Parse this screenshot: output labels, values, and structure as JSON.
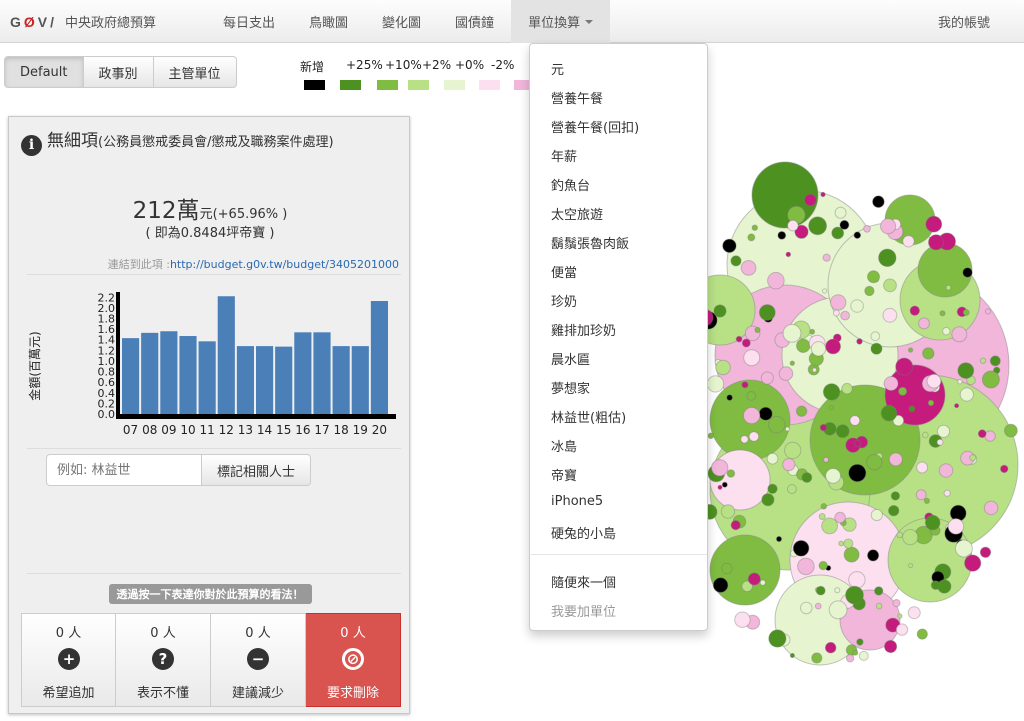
{
  "navbar": {
    "logo": "GØV",
    "brand_title": "中央政府總預算",
    "items": [
      {
        "label": "每日支出"
      },
      {
        "label": "鳥瞰圖"
      },
      {
        "label": "變化圖"
      },
      {
        "label": "國債鐘"
      },
      {
        "label": "單位換算"
      }
    ],
    "account": "我的帳號"
  },
  "view_buttons": [
    "Default",
    "政事別",
    "主管單位"
  ],
  "legend": {
    "labels": [
      "新增",
      "+25%",
      "+10%",
      "+2%",
      "+0%",
      "-2%"
    ],
    "colors": [
      "#000000",
      "#4d9221",
      "#7fbc41",
      "#b8e186",
      "#e6f5d0",
      "#fde0ef",
      "#f1b6da"
    ]
  },
  "panel": {
    "title": "無細項",
    "subtitle": "(公務員懲戒委員會/懲戒及職務案件處理)",
    "amount": "212萬",
    "amount_unit": "元",
    "change": "(+65.96% )",
    "equiv": "( 即為0.8484坪帝寶 )",
    "link_label": "連結到此項 :",
    "link_url": "http://budget.g0v.tw/budget/3405201000",
    "search_placeholder": "例如: 林益世",
    "search_button": "標記相關人士",
    "opinion_prompt": "透過按一下表達你對於此預算的看法！",
    "votes": [
      {
        "count": "0 人",
        "label": "希望追加",
        "icon": "plus-icon"
      },
      {
        "count": "0 人",
        "label": "表示不懂",
        "icon": "question-icon"
      },
      {
        "count": "0 人",
        "label": "建議減少",
        "icon": "minus-icon"
      },
      {
        "count": "0 人",
        "label": "要求刪除",
        "icon": "ban-icon"
      }
    ]
  },
  "chart_data": {
    "type": "bar",
    "ylabel": "金額(百萬元)",
    "categories": [
      "07",
      "08",
      "09",
      "10",
      "11",
      "12",
      "13",
      "14",
      "15",
      "16",
      "17",
      "18",
      "19",
      "20"
    ],
    "values": [
      1.43,
      1.53,
      1.56,
      1.47,
      1.37,
      2.22,
      1.28,
      1.28,
      1.27,
      1.54,
      1.54,
      1.28,
      1.28,
      2.13
    ],
    "yticks": [
      "0.0",
      "0.2",
      "0.4",
      "0.6",
      "0.8",
      "1.0",
      "1.2",
      "1.4",
      "1.6",
      "1.8",
      "2.0",
      "2.2"
    ],
    "ylim": [
      0,
      2.3
    ],
    "color": "#4a7fb8"
  },
  "dropdown": {
    "items": [
      "元",
      "營養午餐",
      "營養午餐(回扣)",
      "年薪",
      "釣魚台",
      "太空旅遊",
      "鬍鬚張魯肉飯",
      "便當",
      "珍奶",
      "雞排加珍奶",
      "晨水匾",
      "夢想家",
      "林益世(粗估)",
      "冰島",
      "帝寶",
      "iPhone5",
      "硬兔的小島"
    ],
    "extra": [
      "隨便來一個"
    ],
    "muted": "我要加單位"
  }
}
